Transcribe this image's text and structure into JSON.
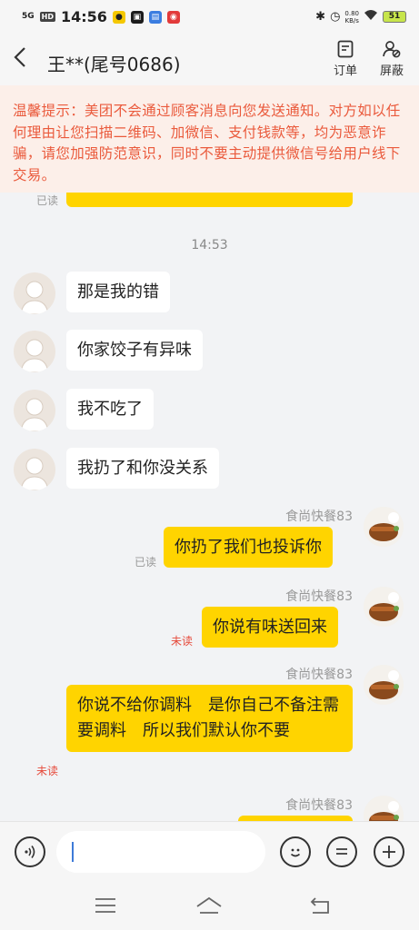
{
  "status_bar": {
    "network": "5G",
    "hd": "HD",
    "time": "14:56",
    "net_speed_value": "0.80",
    "net_speed_unit": "KB/s",
    "battery": "51"
  },
  "header": {
    "title": "王**(尾号0686)",
    "order_label": "订单",
    "block_label": "屏蔽"
  },
  "warning": {
    "text": "温馨提示：美团不会通过顾客消息向您发送通知。对方如以任何理由让您扫描二维码、加微信、支付钱款等，均为恶意诈骗，请您加强防范意识，同时不要主动提供微信号给用户线下交易。"
  },
  "chat": {
    "top_read_status": "已读",
    "timestamp": "14:53",
    "customer_messages": [
      "那是我的错",
      "你家饺子有异味",
      "我不吃了",
      "我扔了和你没关系"
    ],
    "merchant_name": "食尚快餐83",
    "merchant_messages": [
      {
        "text": "你扔了我们也投诉你",
        "status": "已读"
      },
      {
        "text": "你说有味送回来",
        "status": "未读"
      },
      {
        "text": "你说不给你调料　是你自己不备注需要调料　所以我们默认你不要",
        "status": "未读"
      }
    ]
  },
  "input": {
    "placeholder": "",
    "value": ""
  },
  "colors": {
    "bubble_merchant": "#ffd400",
    "warning_text": "#ea5a3c",
    "warning_bg": "#fcefe9",
    "unread": "#e64a3b"
  }
}
